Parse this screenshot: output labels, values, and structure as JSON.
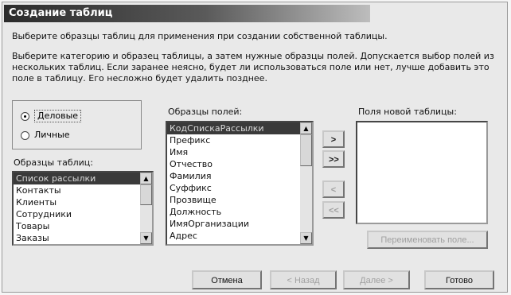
{
  "window": {
    "title": "Создание таблиц"
  },
  "intro": {
    "line1": "Выберите образцы таблиц для применения при создании собственной таблицы.",
    "line2": "Выберите категорию и образец таблицы, а затем нужные образцы полей. Допускается выбор полей из нескольких таблиц. Если заранее неясно, будет ли использоваться поле или нет, лучше добавить это поле в таблицу. Его несложно будет удалить позднее."
  },
  "categories": {
    "options": [
      {
        "label": "Деловые",
        "checked": true
      },
      {
        "label": "Личные",
        "checked": false
      }
    ]
  },
  "sample_tables": {
    "label": "Образцы таблиц:",
    "items": [
      "Список рассылки",
      "Контакты",
      "Клиенты",
      "Сотрудники",
      "Товары",
      "Заказы"
    ],
    "selected_index": 0
  },
  "sample_fields": {
    "label": "Образцы полей:",
    "items": [
      "КодСпискаРассылки",
      "Префикс",
      "Имя",
      "Отчество",
      "Фамилия",
      "Суффикс",
      "Прозвище",
      "Должность",
      "ИмяОрганизации",
      "Адрес"
    ],
    "selected_index": 0
  },
  "new_fields": {
    "label": "Поля новой таблицы:",
    "items": []
  },
  "move_buttons": {
    "add_one": ">",
    "add_all": ">>",
    "remove_one": "<",
    "remove_all": "<<"
  },
  "rename_button": "Переименовать поле...",
  "footer": {
    "cancel": "Отмена",
    "back": "< Назад",
    "next": "Далее >",
    "finish": "Готово"
  },
  "icons": {
    "scroll_up": "▲",
    "scroll_down": "▼"
  }
}
